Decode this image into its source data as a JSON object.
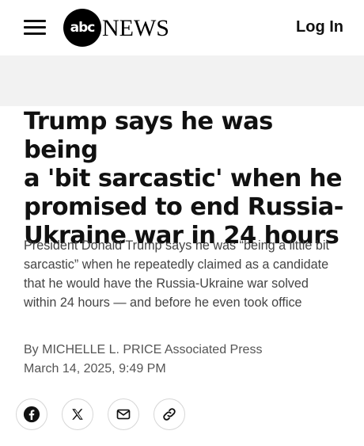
{
  "header": {
    "logo_mark": "abc",
    "logo_text": "NEWS",
    "login_label": "Log In",
    "icons": [
      "menu-icon"
    ]
  },
  "article": {
    "headline_lines": [
      "Trump says he was being",
      "a 'bit sarcastic' when he",
      "promised to end Russia-",
      "Ukraine war in 24 hours"
    ],
    "dek_lines": [
      "President Donald Trump says he was “being a little bit",
      "sarcastic” when he repeatedly claimed as a candidate",
      "that he would have the Russia-Ukraine war solved",
      "within 24 hours — and before he even took office"
    ],
    "byline": "By MICHELLE L. PRICE Associated Press",
    "date": "March 14, 2025, 9:49 PM"
  },
  "share": {
    "buttons": [
      {
        "icon": "facebook-icon"
      },
      {
        "icon": "x-icon"
      },
      {
        "icon": "email-icon"
      },
      {
        "icon": "link-icon"
      }
    ]
  },
  "colors": {
    "ad_band": "#f2f2f2",
    "text_primary": "#111111",
    "text_secondary": "#444444",
    "byline": "#555555",
    "button_border": "#d6d6d6"
  }
}
